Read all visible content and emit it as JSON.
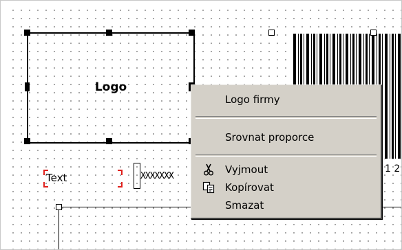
{
  "logo_object": {
    "text": "Logo"
  },
  "text_object": {
    "text": "Text"
  },
  "barcode": {
    "digits": "1 2"
  },
  "context_menu": {
    "items": [
      {
        "label": "Logo firmy",
        "icon": ""
      },
      {
        "label": "Srovnat proporce",
        "icon": ""
      },
      {
        "label": "Vyjmout",
        "icon": "scissors-icon"
      },
      {
        "label": "Kopírovat",
        "icon": "copy-icon"
      },
      {
        "label": "Smazat",
        "icon": ""
      }
    ]
  },
  "colors": {
    "menu_bg": "#d4d0c8",
    "accent_red": "#e0201c"
  }
}
